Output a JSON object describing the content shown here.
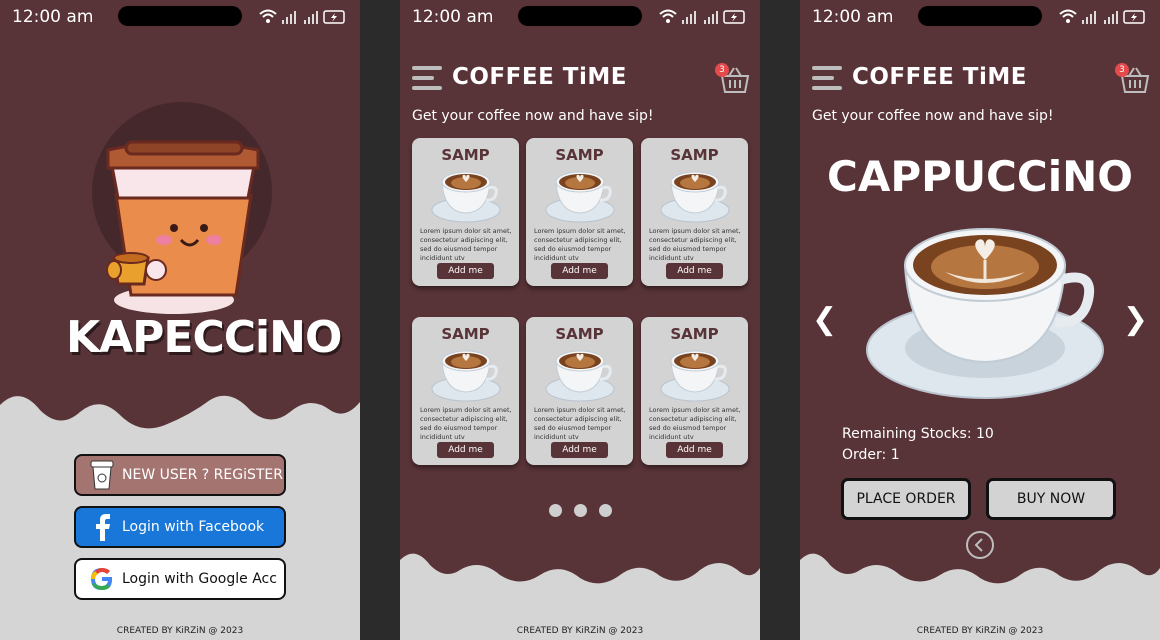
{
  "status": {
    "time": "12:00 am"
  },
  "screen1": {
    "brand": "KAPECCiNO",
    "buttons": [
      {
        "label": "NEW USER ? REGiSTER",
        "icon": "cup-icon"
      },
      {
        "label": "Login with Facebook",
        "icon": "facebook-icon"
      },
      {
        "label": "Login with Google Acc",
        "icon": "google-icon"
      }
    ],
    "footer": "CREATED BY KiRZiN @ 2023"
  },
  "screen2": {
    "title": "COFFEE TiME",
    "cart_count": "3",
    "subtitle": "Get your coffee now and have sip!",
    "cards": [
      {
        "title": "SAMP",
        "desc": "Lorem ipsum dolor sit amet, consectetur adipiscing elit, sed do eiusmod tempor incididunt utv",
        "button": "Add me"
      },
      {
        "title": "SAMP",
        "desc": "Lorem ipsum dolor sit amet, consectetur adipiscing elit, sed do eiusmod tempor incididunt utv",
        "button": "Add me"
      },
      {
        "title": "SAMP",
        "desc": "Lorem ipsum dolor sit amet, consectetur adipiscing elit, sed do eiusmod tempor incididunt utv",
        "button": "Add me"
      },
      {
        "title": "SAMP",
        "desc": "Lorem ipsum dolor sit amet, consectetur adipiscing elit, sed do eiusmod tempor incididunt utv",
        "button": "Add me"
      },
      {
        "title": "SAMP",
        "desc": "Lorem ipsum dolor sit amet, consectetur adipiscing elit, sed do eiusmod tempor incididunt utv",
        "button": "Add me"
      },
      {
        "title": "SAMP",
        "desc": "Lorem ipsum dolor sit amet, consectetur adipiscing elit, sed do eiusmod tempor incididunt utv",
        "button": "Add me"
      }
    ],
    "page_dots": 3,
    "footer": "CREATED BY KiRZiN @ 2023"
  },
  "screen3": {
    "title": "COFFEE TiME",
    "cart_count": "3",
    "subtitle": "Get your coffee now and have sip!",
    "product": "CAPPUCCiNO",
    "stocks": "Remaining Stocks: 10",
    "order": "Order: 1",
    "place_order": "PLACE ORDER",
    "buy_now": "BUY NOW",
    "footer": "CREATED BY KiRZiN @ 2023"
  },
  "colors": {
    "background": "#583337",
    "card": "#d3d3d3",
    "accent": "#a47471",
    "facebook": "#1877d9"
  }
}
